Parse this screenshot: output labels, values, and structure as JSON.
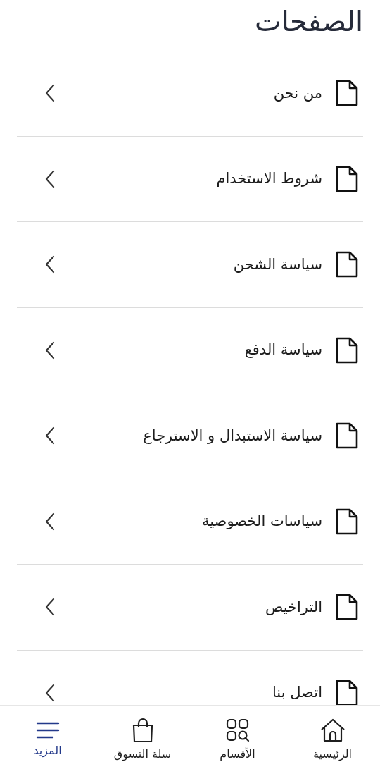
{
  "header": {
    "title": "الصفحات"
  },
  "pages": [
    {
      "label": "من نحن"
    },
    {
      "label": "شروط الاستخدام"
    },
    {
      "label": "سياسة الشحن"
    },
    {
      "label": "سياسة الدفع"
    },
    {
      "label": "سياسة الاستبدال و الاسترجاع"
    },
    {
      "label": "سياسات الخصوصية"
    },
    {
      "label": "التراخيص"
    },
    {
      "label": "اتصل بنا"
    }
  ],
  "bottom_nav": [
    {
      "kind": "home",
      "label": "الرئيسية",
      "selected": false
    },
    {
      "kind": "categories",
      "label": "الأقسام",
      "selected": false
    },
    {
      "kind": "cart",
      "label": "سلة التسوق",
      "selected": false
    },
    {
      "kind": "more",
      "label": "المزيد",
      "selected": true
    }
  ]
}
